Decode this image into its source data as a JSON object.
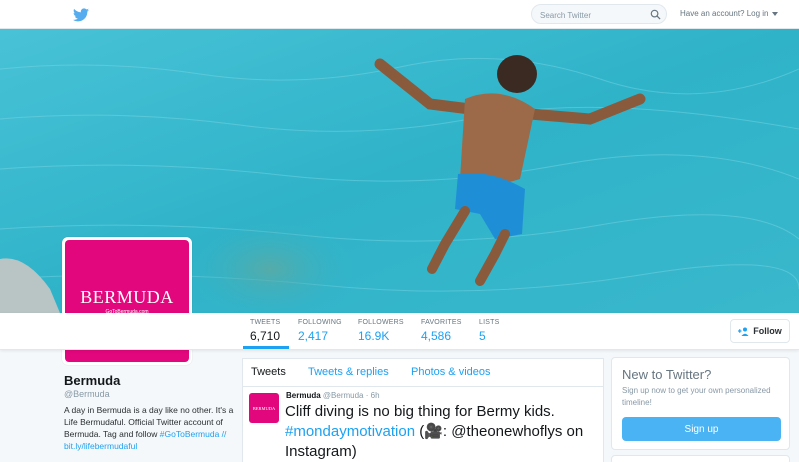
{
  "topbar": {
    "search_placeholder": "Search Twitter",
    "login_label": "Have an account? Log in",
    "icons": {
      "logo": "twitter-bird-icon",
      "search": "search-icon",
      "caret": "caret-down-icon"
    }
  },
  "header": {
    "image": "man jumping into turquoise water",
    "colors": {
      "water": "#2fb3c9",
      "water_dark": "#1687a1"
    }
  },
  "avatar": {
    "brand": "BERMUDA",
    "brand_sub": "GoToBermuda.com",
    "color": "#e2077d"
  },
  "stats": [
    {
      "label": "TWEETS",
      "value": "6,710"
    },
    {
      "label": "FOLLOWING",
      "value": "2,417"
    },
    {
      "label": "FOLLOWERS",
      "value": "16.9K"
    },
    {
      "label": "FAVORITES",
      "value": "4,586"
    },
    {
      "label": "LISTS",
      "value": "5"
    }
  ],
  "follow_label": "Follow",
  "profile": {
    "name": "Bermuda",
    "handle": "@Bermuda",
    "bio": "A day in Bermuda is a day like no other. It's a Life Bermudaful. Official Twitter account of Bermuda. Tag and follow",
    "bio_links": "#GoToBermuda // bit.ly/lifebermudaful"
  },
  "tabs": [
    "Tweets",
    "Tweets & replies",
    "Photos & videos"
  ],
  "tweet": {
    "name": "Bermuda",
    "handle": "@Bermuda",
    "time": "· 6h",
    "avatar_brand": "BERMUDA",
    "text_1": "Cliff diving is no big thing for Bermy kids.",
    "hashtag": "#mondaymotivation",
    "text_2": " (🎥: @theonewhoflys on Instagram)"
  },
  "signup": {
    "title": "New to Twitter?",
    "subtitle": "Sign up now to get your own personalized timeline!",
    "button": "Sign up"
  },
  "colors": {
    "accent": "#1da1f2",
    "signup_button": "#4ab3f4"
  }
}
